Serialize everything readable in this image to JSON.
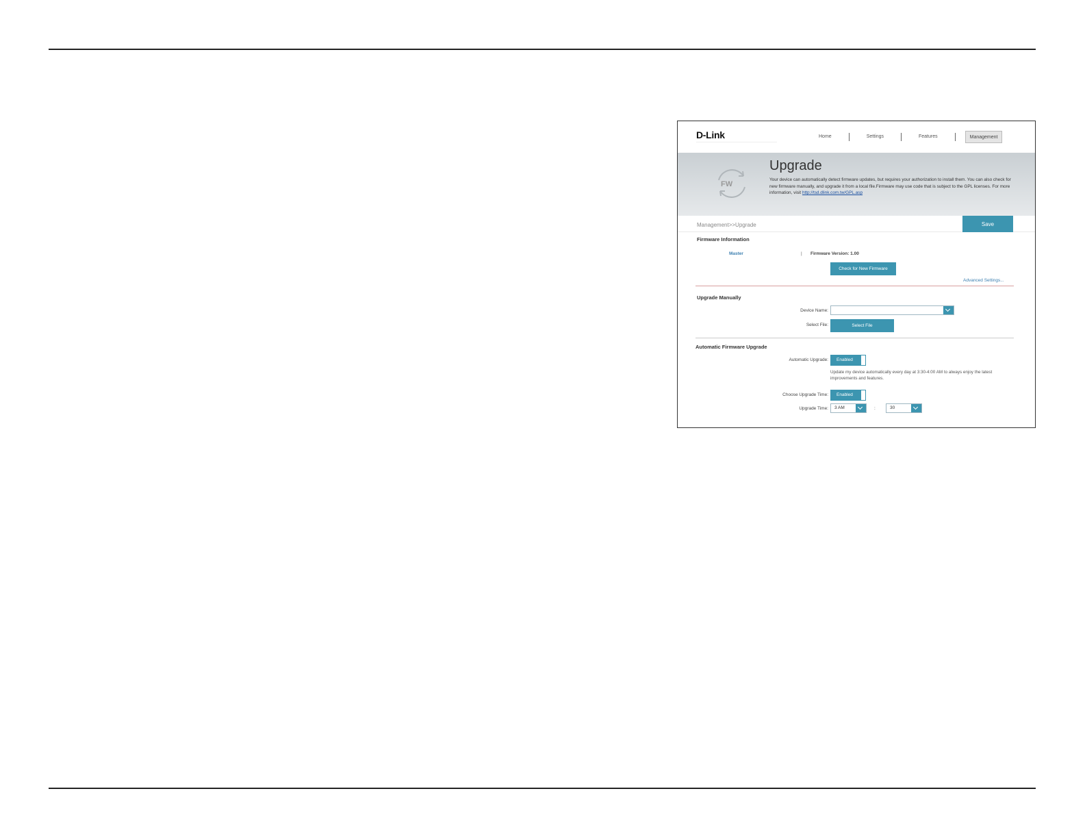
{
  "window": {
    "logo": "D-Link",
    "nav": [
      "Home",
      "Settings",
      "Features",
      "Management"
    ]
  },
  "banner": {
    "icon_text": "FW",
    "title": "Upgrade",
    "description": "Your device can automatically detect firmware updates, but requires your authorization to install them. You can also check for new firmware manually, and upgrade it from a local file.Firmware may use code that is subject to the GPL licenses. For more information, visit",
    "link": "http://tsd.dlink.com.tw/GPL.asp"
  },
  "breadcrumb": "Management>>Upgrade",
  "save_label": "Save",
  "firmware_info": {
    "title": "Firmware Information",
    "device": "Master",
    "separator": "|",
    "version": "Firmware Version: 1.00",
    "check_button": "Check for New Firmware",
    "advanced_link": "Advanced Settings..."
  },
  "upgrade_manually": {
    "title": "Upgrade Manually",
    "device_name_label": "Device Name:",
    "device_name_value": "",
    "select_file_label": "Select File:",
    "select_file_button": "Select File"
  },
  "auto_upgrade": {
    "title": "Automatic Firmware Upgrade",
    "auto_label": "Automatic Upgrade:",
    "auto_state": "Enabled",
    "note": "Update my device automatically every day at 3:30-4:00 AM to always enjoy the latest improvements and features.",
    "choose_time_label": "Choose Upgrade Time:",
    "choose_time_state": "Enabled",
    "upgrade_time_label": "Upgrade Time:",
    "hour": "3 AM",
    "colon": ":",
    "minute": "30"
  },
  "colors": {
    "accent": "#3c95b0"
  }
}
